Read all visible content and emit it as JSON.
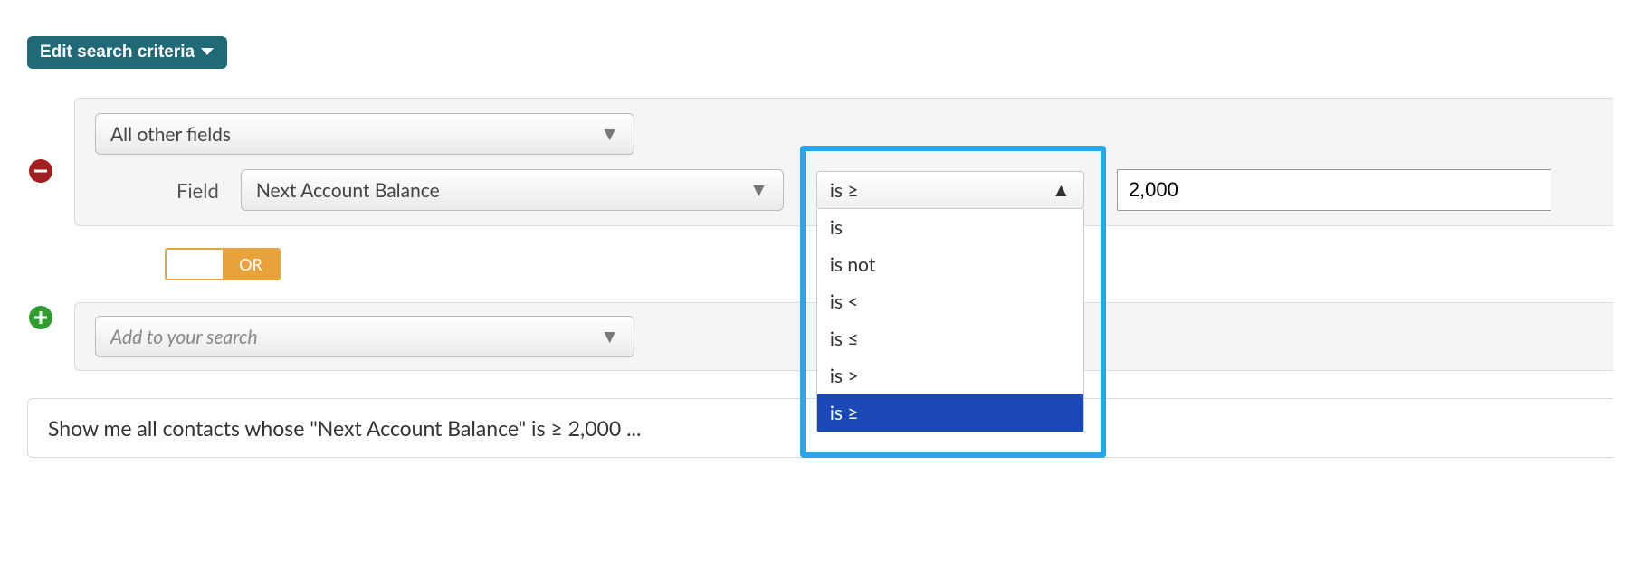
{
  "header": {
    "edit_label": "Edit search criteria"
  },
  "criteria": {
    "category_selected": "All other fields",
    "field_label": "Field",
    "field_selected": "Next Account Balance",
    "operator_selected": "is ≥",
    "operator_options": [
      "is",
      "is not",
      "is <",
      "is ≤",
      "is >",
      "is ≥"
    ],
    "value": "2,000"
  },
  "logic": {
    "and_label": "",
    "or_label": "OR"
  },
  "add_search_placeholder": "Add to your search",
  "summary_text": "Show me all contacts whose \"Next Account Balance\" is ≥ 2,000 ..."
}
